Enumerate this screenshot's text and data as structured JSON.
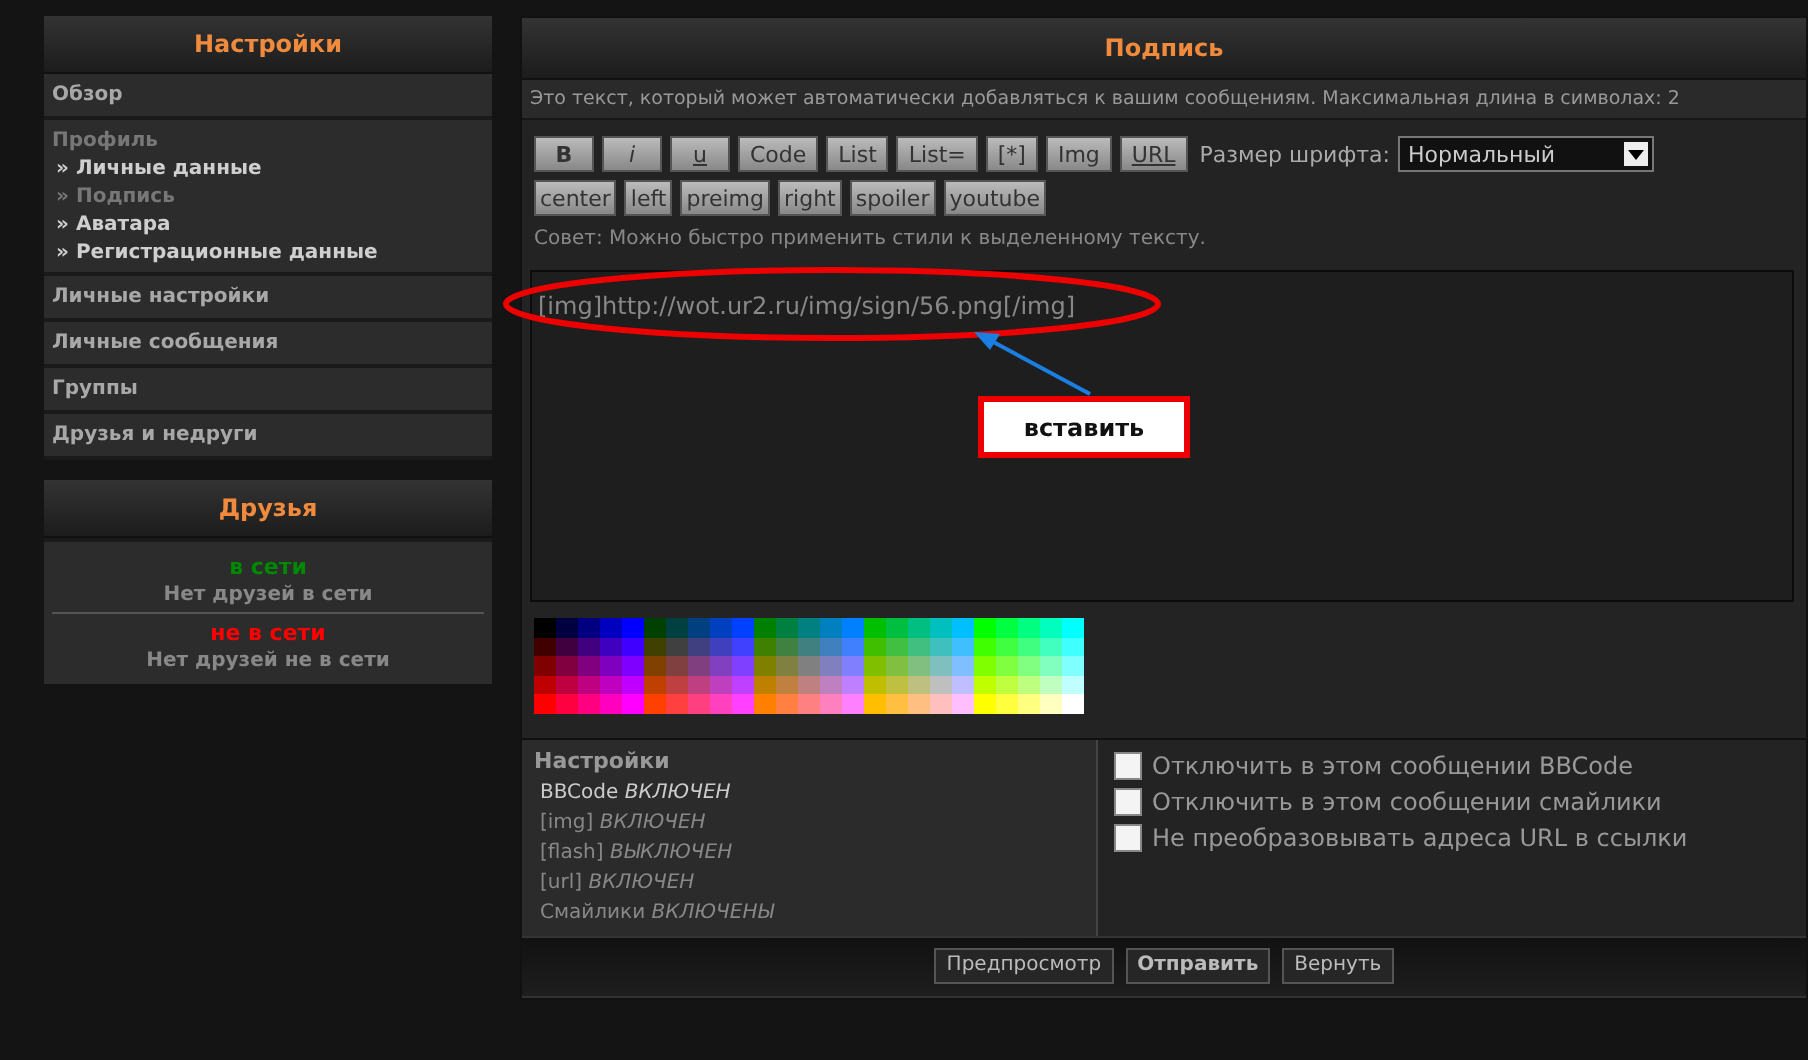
{
  "sidebar": {
    "title": "Настройки",
    "sections": [
      {
        "label": "Обзор"
      },
      {
        "label": "Профиль",
        "children": [
          {
            "bullet": "»",
            "label": "Личные данные",
            "selected": false
          },
          {
            "bullet": "»",
            "label": "Подпись",
            "selected": true
          },
          {
            "bullet": "»",
            "label": "Аватара",
            "selected": false
          },
          {
            "bullet": "»",
            "label": "Регистрационные данные",
            "selected": false
          }
        ]
      },
      {
        "label": "Личные настройки"
      },
      {
        "label": "Личные сообщения"
      },
      {
        "label": "Группы"
      },
      {
        "label": "Друзья и недруги"
      }
    ]
  },
  "friends": {
    "title": "Друзья",
    "groups": [
      {
        "label": "в сети",
        "color": "#008800",
        "empty": "Нет друзей в сети"
      },
      {
        "label": "не в сети",
        "color": "#ff0000",
        "empty": "Нет друзей не в сети"
      }
    ]
  },
  "panel": {
    "title": "Подпись",
    "description": "Это текст, который может автоматически добавляться к вашим сообщениям. Максимальная длина в символах: 2",
    "toolbar": [
      {
        "label": "B",
        "kind": "bold"
      },
      {
        "label": "i",
        "kind": "italic"
      },
      {
        "label": "u",
        "kind": "underline"
      },
      {
        "label": "Code",
        "kind": "plain"
      },
      {
        "label": "List",
        "kind": "plain"
      },
      {
        "label": "List=",
        "kind": "plain"
      },
      {
        "label": "[*]",
        "kind": "plain"
      },
      {
        "label": "Img",
        "kind": "plain"
      },
      {
        "label": "URL",
        "kind": "underline"
      }
    ],
    "font_size": {
      "label": "Размер шрифта:",
      "value": "Нормальный"
    },
    "toolbar2": [
      {
        "label": "center"
      },
      {
        "label": "left"
      },
      {
        "label": "preimg"
      },
      {
        "label": "right"
      },
      {
        "label": "spoiler"
      },
      {
        "label": "youtube"
      }
    ],
    "hint": "Совет: Можно быстро применить стили к выделенному тексту.",
    "text_value": "[img]http://wot.ur2.ru/img/sign/56.png[/img]",
    "callout": "вставить",
    "settings": {
      "title": "Настройки",
      "items": [
        "BBCode *ВКЛЮЧЕН*",
        "[img] *ВКЛЮЧЕН*",
        "[flash] *ВЫКЛЮЧЕН*",
        "[url] *ВКЛЮЧЕН*",
        "Смайлики *ВКЛЮЧЕНЫ*"
      ]
    },
    "options": [
      {
        "label": "Отключить в этом сообщении BBCode",
        "checked": false
      },
      {
        "label": "Отключить в этом сообщении смайлики",
        "checked": false
      },
      {
        "label": "Не преобразовывать адреса URL в ссылки",
        "checked": false
      }
    ],
    "buttons": [
      {
        "label": "Предпросмотр",
        "kind": "default"
      },
      {
        "label": "Отправить",
        "kind": "primary"
      },
      {
        "label": "Вернуть",
        "kind": "default"
      }
    ]
  }
}
